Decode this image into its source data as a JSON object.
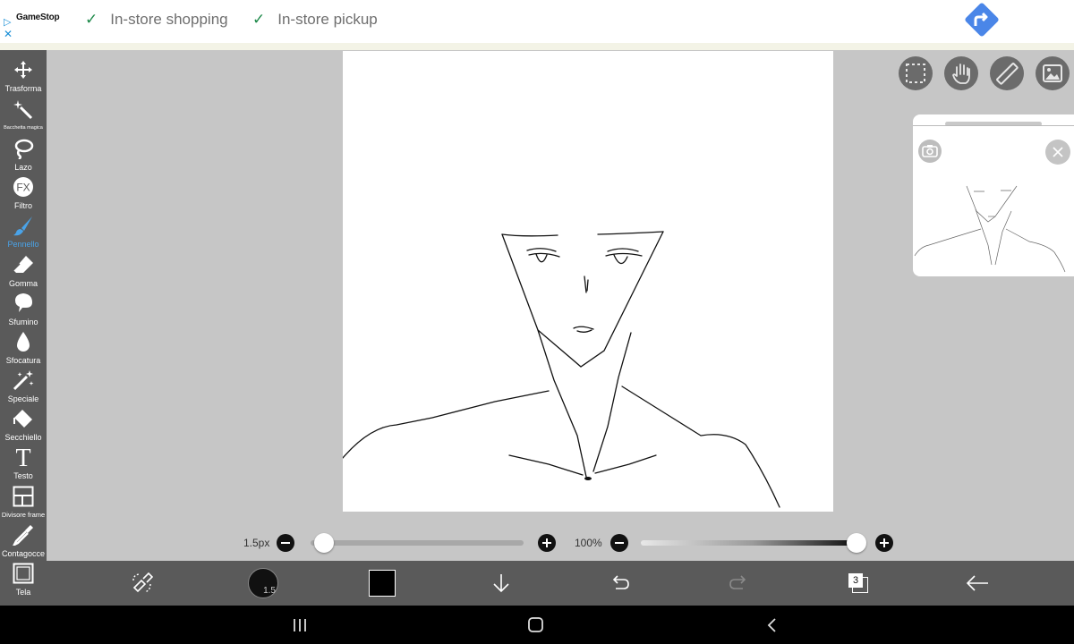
{
  "ad": {
    "brand": "GameStop",
    "features": [
      "In-store shopping",
      "In-store pickup"
    ],
    "directions_icon": "directions-icon"
  },
  "tools": [
    {
      "label": "Trasforma",
      "icon": "move-icon"
    },
    {
      "label": "Bacchetta magica",
      "icon": "magic-wand-icon"
    },
    {
      "label": "Lazo",
      "icon": "lasso-icon"
    },
    {
      "label": "Filtro",
      "icon": "fx-icon",
      "glyph": "FX"
    },
    {
      "label": "Pennello",
      "icon": "brush-icon",
      "active": true
    },
    {
      "label": "Gomma",
      "icon": "eraser-icon"
    },
    {
      "label": "Sfumino",
      "icon": "smudge-icon"
    },
    {
      "label": "Sfocatura",
      "icon": "blur-icon"
    },
    {
      "label": "Speciale",
      "icon": "special-icon"
    },
    {
      "label": "Secchiello",
      "icon": "bucket-icon"
    },
    {
      "label": "Testo",
      "icon": "text-icon",
      "glyph": "T"
    },
    {
      "label": "Divisore frame",
      "icon": "frame-divider-icon"
    },
    {
      "label": "Contagocce",
      "icon": "eyedropper-icon"
    },
    {
      "label": "Tela",
      "icon": "canvas-icon"
    }
  ],
  "right_tools": [
    "selection-icon",
    "hand-icon",
    "ruler-icon",
    "image-icon"
  ],
  "sliders": {
    "size_label": "1.5px",
    "size_value": 0.02,
    "opacity_label": "100%",
    "opacity_value": 1.0
  },
  "actions": {
    "brush_size_badge": "1.5",
    "color": "#000000",
    "layers_count": "3"
  },
  "colors": {
    "toolbar_bg": "#5a5a5a",
    "workspace_bg": "#c6c6c6",
    "active_tool": "#4aa3e8",
    "accent": "#1a73e8"
  }
}
